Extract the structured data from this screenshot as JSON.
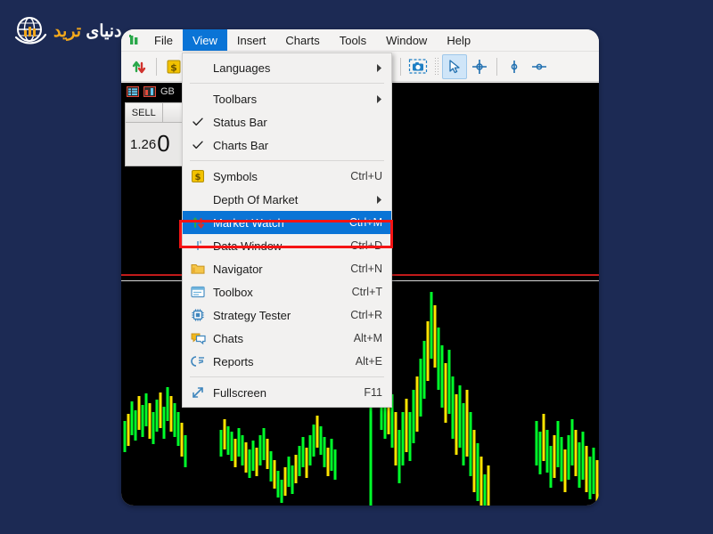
{
  "watermark": {
    "brand_text_1": "دنیای",
    "brand_text_2": "ترید",
    "icon": "globe-chart-logo",
    "color_gold": "#f3a81c",
    "color_white": "#ffffff"
  },
  "background_color": "#1c2a54",
  "app": {
    "menubar": {
      "logo_icon": "metatrader-logo-icon",
      "items": [
        {
          "label": "File",
          "active": false
        },
        {
          "label": "View",
          "active": true
        },
        {
          "label": "Insert",
          "active": false
        },
        {
          "label": "Charts",
          "active": false
        },
        {
          "label": "Tools",
          "active": false
        },
        {
          "label": "Window",
          "active": false
        },
        {
          "label": "Help",
          "active": false
        }
      ]
    },
    "toolbar": {
      "buttons": [
        {
          "name": "new-order-icon",
          "selected": false
        },
        {
          "name": "symbols-dollar-icon",
          "selected": false
        },
        {
          "name": "screenshot-icon",
          "selected": false
        },
        {
          "name": "cursor-arrow-icon",
          "selected": true
        },
        {
          "name": "crosshair-icon",
          "selected": false
        },
        {
          "name": "vertical-line-icon",
          "selected": false
        },
        {
          "name": "horizontal-line-icon",
          "selected": false
        }
      ]
    },
    "chart": {
      "symbol_label": "GB",
      "symbol_icons": [
        "market-watch-grid-icon",
        "chart-bars-icon"
      ],
      "trade_panel": {
        "sell_label": "SELL",
        "buy_label": "",
        "price_small": "1.26",
        "price_big": "0"
      },
      "line_colors": {
        "resistance": "#c21a1a",
        "support": "#ffffff"
      },
      "candle_colors": {
        "up": "#00ff2a",
        "down": "#ffe400"
      },
      "background": "#000000"
    },
    "view_menu": {
      "items": [
        {
          "label": "Languages",
          "accel": "",
          "icon": "",
          "submenu": true,
          "checked": false,
          "selected": false
        },
        {
          "separator": true
        },
        {
          "label": "Toolbars",
          "accel": "",
          "icon": "",
          "submenu": true,
          "checked": false,
          "selected": false
        },
        {
          "label": "Status Bar",
          "accel": "",
          "icon": "check",
          "submenu": false,
          "checked": true,
          "selected": false
        },
        {
          "label": "Charts Bar",
          "accel": "",
          "icon": "check",
          "submenu": false,
          "checked": true,
          "selected": false
        },
        {
          "separator": true
        },
        {
          "label": "Symbols",
          "accel": "Ctrl+U",
          "icon": "dollar-badge-icon",
          "submenu": false,
          "checked": false,
          "selected": false
        },
        {
          "label": "Depth Of Market",
          "accel": "",
          "icon": "",
          "submenu": true,
          "checked": false,
          "selected": false
        },
        {
          "label": "Market Watch",
          "accel": "Ctrl+M",
          "icon": "up-down-arrows-icon",
          "submenu": false,
          "checked": false,
          "selected": true
        },
        {
          "label": "Data Window",
          "accel": "Ctrl+D",
          "icon": "data-crosshair-icon",
          "submenu": false,
          "checked": false,
          "selected": false
        },
        {
          "label": "Navigator",
          "accel": "Ctrl+N",
          "icon": "folder-icon",
          "submenu": false,
          "checked": false,
          "selected": false
        },
        {
          "label": "Toolbox",
          "accel": "Ctrl+T",
          "icon": "toolbox-panel-icon",
          "submenu": false,
          "checked": false,
          "selected": false
        },
        {
          "label": "Strategy Tester",
          "accel": "Ctrl+R",
          "icon": "cpu-chip-icon",
          "submenu": false,
          "checked": false,
          "selected": false
        },
        {
          "label": "Chats",
          "accel": "Alt+M",
          "icon": "chat-bubble-icon",
          "submenu": false,
          "checked": false,
          "selected": false
        },
        {
          "label": "Reports",
          "accel": "Alt+E",
          "icon": "reports-icon",
          "submenu": false,
          "checked": false,
          "selected": false
        },
        {
          "separator": true
        },
        {
          "label": "Fullscreen",
          "accel": "F11",
          "icon": "fullscreen-arrow-icon",
          "submenu": false,
          "checked": false,
          "selected": false
        }
      ]
    },
    "annotation": {
      "target_label": "Market Watch",
      "box_color": "#f51414"
    }
  }
}
